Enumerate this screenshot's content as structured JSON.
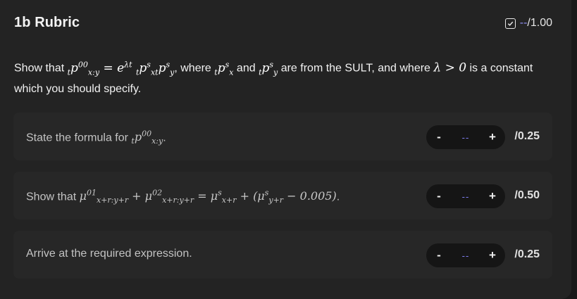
{
  "header": {
    "title": "1b Rubric",
    "score": {
      "current": "--",
      "max": "/1.00"
    }
  },
  "question": {
    "prefix": "Show that ",
    "middle1": ", where ",
    "middle2": " and ",
    "middle3": " are from the SULT, and where ",
    "suffix": " is a constant which you should specify."
  },
  "criteria": [
    {
      "label_prefix": "State the formula for ",
      "label_suffix": ".",
      "score": "--",
      "max": "/0.25"
    },
    {
      "label_prefix": "Show that ",
      "label_suffix": ".",
      "score": "--",
      "max": "/0.50"
    },
    {
      "label_prefix": "Arrive at the required expression.",
      "label_suffix": "",
      "score": "--",
      "max": "/0.25"
    }
  ],
  "stepper": {
    "minus": "-",
    "plus": "+"
  },
  "icons": {
    "score_status": "checkbox-check-icon"
  },
  "colors": {
    "accent": "#7f7ff2",
    "panel": "#232323",
    "row": "#272727"
  }
}
